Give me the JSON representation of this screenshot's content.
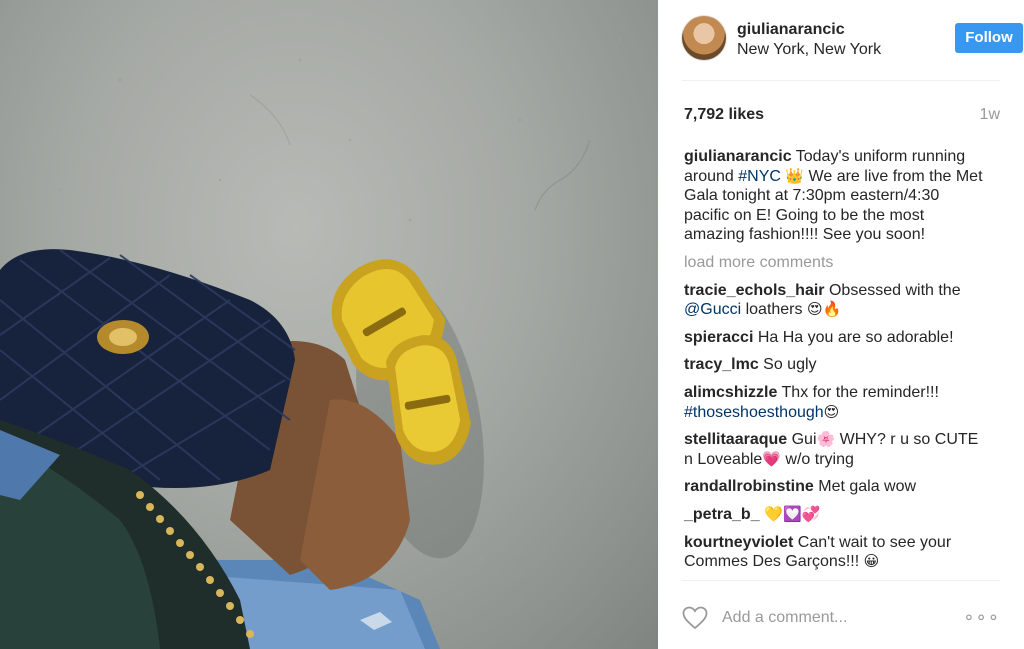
{
  "post": {
    "username": "giulianarancic",
    "location": "New York, New York",
    "follow_label": "Follow",
    "likes": "7,792 likes",
    "time": "1w",
    "caption": {
      "user": "giulianarancic",
      "part1": " Today's uniform running around ",
      "hashtag": "#NYC",
      "emoji": "👑",
      "part2": " We are live from the Met Gala tonight at 7:30pm eastern/4:30 pacific on E! Going to be the most amazing fashion!!!! See you soon!"
    },
    "load_more": "load more comments",
    "comments": [
      {
        "user": "tracie_echols_hair",
        "text1": " Obsessed with the ",
        "link": "@Gucci",
        "text2": " loathers ",
        "emoji": "😍🔥"
      },
      {
        "user": "spieracci",
        "text1": " Ha Ha you are so adorable!"
      },
      {
        "user": "tracy_lmc",
        "text1": " So ugly"
      },
      {
        "user": "alimcshizzle",
        "text1": " Thx for the reminder!!! ",
        "link": "#thoseshoesthough",
        "emoji": "😍"
      },
      {
        "user": "stellitaaraque",
        "text1": " Gui",
        "emoji": "🌸",
        "text2": " WHY? r u so CUTE n Loveable",
        "emoji2": "💗",
        "text3": " w/o trying"
      },
      {
        "user": "randallrobinstine",
        "text1": " Met gala wow"
      },
      {
        "user": "_petra_b_",
        "emoji": " 💛💟💞"
      },
      {
        "user": "kourtneyviolet",
        "text1": " Can't wait to see your Commes Des Garçons!!! ",
        "emoji": "😀"
      }
    ],
    "add_comment_placeholder": "Add a comment...",
    "more_icon": "more-options-icon"
  }
}
